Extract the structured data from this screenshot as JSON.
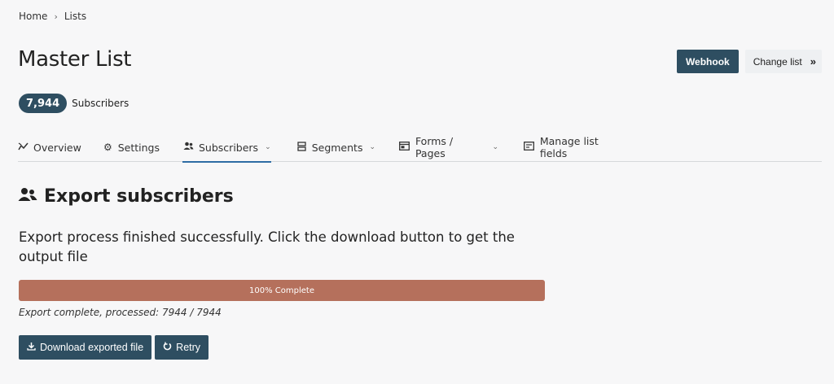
{
  "breadcrumb": {
    "home": "Home",
    "separator": "›",
    "current": "Lists"
  },
  "page": {
    "title": "Master List"
  },
  "header_actions": {
    "webhook": "Webhook",
    "change_list": "Change list",
    "change_list_icon": "»"
  },
  "subscribers_count": {
    "count": "7,944",
    "label": "Subscribers"
  },
  "tabs": [
    {
      "label": "Overview",
      "icon": "chart-line-icon",
      "glyph": "⟋",
      "dropdown": false
    },
    {
      "label": "Settings",
      "icon": "gear-icon",
      "glyph": "⚙",
      "dropdown": false
    },
    {
      "label": "Subscribers",
      "icon": "users-icon",
      "glyph": "👥",
      "dropdown": true,
      "active": true
    },
    {
      "label": "Segments",
      "icon": "segments-icon",
      "glyph": "☰",
      "dropdown": true
    },
    {
      "label": "Forms / Pages",
      "icon": "form-icon",
      "glyph": "▤",
      "dropdown": true
    },
    {
      "label": "Manage list fields",
      "icon": "fields-icon",
      "glyph": "▣",
      "dropdown": false
    }
  ],
  "caret": "⌄",
  "section": {
    "title": "Export subscribers",
    "icon": "users-icon"
  },
  "export": {
    "message": "Export process finished successfully. Click the download button to get the output file",
    "progress_percent": 100,
    "progress_label": "100% Complete",
    "note": "Export complete, processed: 7944 / 7944"
  },
  "buttons": {
    "download": "Download exported file",
    "retry": "Retry"
  },
  "colors": {
    "primary": "#2e4e61",
    "progress": "#b5705c",
    "active_tab": "#2e6da4"
  }
}
